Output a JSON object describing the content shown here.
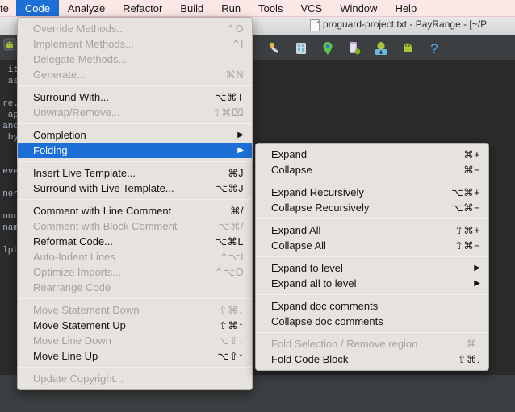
{
  "window": {
    "title": "proguard-project.txt - PayRange - [~/P",
    "doc_icon": "document-icon"
  },
  "toolbar": {
    "icons": [
      {
        "name": "sdk-manager-icon",
        "color": "#e8b54d"
      },
      {
        "name": "avd-manager-icon",
        "color": "#6fb8e0"
      },
      {
        "name": "location-pin-icon",
        "color": "#5fc14e"
      },
      {
        "name": "device-monitor-icon",
        "color": "#c9a3e0"
      },
      {
        "name": "sync-gradle-icon",
        "color": "#6fb8e0"
      },
      {
        "name": "android-icon",
        "color": "#a4c639"
      },
      {
        "name": "help-icon",
        "color": "#4aa3e8"
      }
    ]
  },
  "editor": {
    "lines": [
      "it",
      "as",
      "",
      "re.",
      "ap",
      "and",
      " by",
      "",
      "",
      "eve",
      "",
      "ner",
      "",
      "unc",
      "nam",
      "",
      "lpt"
    ]
  },
  "menubar": {
    "items": [
      {
        "label": "te",
        "active": false,
        "clipped": true
      },
      {
        "label": "Code",
        "active": true,
        "clipped": false
      },
      {
        "label": "Analyze",
        "active": false,
        "clipped": false
      },
      {
        "label": "Refactor",
        "active": false,
        "clipped": false
      },
      {
        "label": "Build",
        "active": false,
        "clipped": false
      },
      {
        "label": "Run",
        "active": false,
        "clipped": false
      },
      {
        "label": "Tools",
        "active": false,
        "clipped": false
      },
      {
        "label": "VCS",
        "active": false,
        "clipped": false
      },
      {
        "label": "Window",
        "active": false,
        "clipped": false
      },
      {
        "label": "Help",
        "active": false,
        "clipped": false
      }
    ]
  },
  "code_menu": {
    "name": "Code",
    "items": [
      {
        "type": "item",
        "label": "Override Methods...",
        "shortcut": "⌃O",
        "disabled": true,
        "submenu": false
      },
      {
        "type": "item",
        "label": "Implement Methods...",
        "shortcut": "⌃I",
        "disabled": true,
        "submenu": false
      },
      {
        "type": "item",
        "label": "Delegate Methods...",
        "shortcut": "",
        "disabled": true,
        "submenu": false
      },
      {
        "type": "item",
        "label": "Generate...",
        "shortcut": "⌘N",
        "disabled": true,
        "submenu": false
      },
      {
        "type": "separator"
      },
      {
        "type": "item",
        "label": "Surround With...",
        "shortcut": "⌥⌘T",
        "disabled": false,
        "submenu": false
      },
      {
        "type": "item",
        "label": "Unwrap/Remove...",
        "shortcut": "⇧⌘⌧",
        "disabled": true,
        "submenu": false
      },
      {
        "type": "separator"
      },
      {
        "type": "item",
        "label": "Completion",
        "shortcut": "",
        "disabled": false,
        "submenu": true
      },
      {
        "type": "item",
        "label": "Folding",
        "shortcut": "",
        "disabled": false,
        "submenu": true,
        "highlight": true
      },
      {
        "type": "separator"
      },
      {
        "type": "item",
        "label": "Insert Live Template...",
        "shortcut": "⌘J",
        "disabled": false,
        "submenu": false
      },
      {
        "type": "item",
        "label": "Surround with Live Template...",
        "shortcut": "⌥⌘J",
        "disabled": false,
        "submenu": false
      },
      {
        "type": "separator"
      },
      {
        "type": "item",
        "label": "Comment with Line Comment",
        "shortcut": "⌘/",
        "disabled": false,
        "submenu": false
      },
      {
        "type": "item",
        "label": "Comment with Block Comment",
        "shortcut": "⌥⌘/",
        "disabled": true,
        "submenu": false
      },
      {
        "type": "item",
        "label": "Reformat Code...",
        "shortcut": "⌥⌘L",
        "disabled": false,
        "submenu": false
      },
      {
        "type": "item",
        "label": "Auto-Indent Lines",
        "shortcut": "⌃⌥I",
        "disabled": true,
        "submenu": false
      },
      {
        "type": "item",
        "label": "Optimize Imports...",
        "shortcut": "⌃⌥O",
        "disabled": true,
        "submenu": false
      },
      {
        "type": "item",
        "label": "Rearrange Code",
        "shortcut": "",
        "disabled": true,
        "submenu": false
      },
      {
        "type": "separator"
      },
      {
        "type": "item",
        "label": "Move Statement Down",
        "shortcut": "⇧⌘↓",
        "disabled": true,
        "submenu": false
      },
      {
        "type": "item",
        "label": "Move Statement Up",
        "shortcut": "⇧⌘↑",
        "disabled": false,
        "submenu": false
      },
      {
        "type": "item",
        "label": "Move Line Down",
        "shortcut": "⌥⇧↓",
        "disabled": true,
        "submenu": false
      },
      {
        "type": "item",
        "label": "Move Line Up",
        "shortcut": "⌥⇧↑",
        "disabled": false,
        "submenu": false
      },
      {
        "type": "separator"
      },
      {
        "type": "item",
        "label": "Update Copyright...",
        "shortcut": "",
        "disabled": true,
        "submenu": false
      }
    ]
  },
  "folding_submenu": {
    "name": "Folding",
    "items": [
      {
        "type": "item",
        "label": "Expand",
        "shortcut": "⌘+",
        "disabled": false,
        "submenu": false
      },
      {
        "type": "item",
        "label": "Collapse",
        "shortcut": "⌘−",
        "disabled": false,
        "submenu": false
      },
      {
        "type": "separator"
      },
      {
        "type": "item",
        "label": "Expand Recursively",
        "shortcut": "⌥⌘+",
        "disabled": false,
        "submenu": false
      },
      {
        "type": "item",
        "label": "Collapse Recursively",
        "shortcut": "⌥⌘−",
        "disabled": false,
        "submenu": false
      },
      {
        "type": "separator"
      },
      {
        "type": "item",
        "label": "Expand All",
        "shortcut": "⇧⌘+",
        "disabled": false,
        "submenu": false
      },
      {
        "type": "item",
        "label": "Collapse All",
        "shortcut": "⇧⌘−",
        "disabled": false,
        "submenu": false
      },
      {
        "type": "separator"
      },
      {
        "type": "item",
        "label": "Expand to level",
        "shortcut": "",
        "disabled": false,
        "submenu": true
      },
      {
        "type": "item",
        "label": "Expand all to level",
        "shortcut": "",
        "disabled": false,
        "submenu": true
      },
      {
        "type": "separator"
      },
      {
        "type": "item",
        "label": "Expand doc comments",
        "shortcut": "",
        "disabled": false,
        "submenu": false
      },
      {
        "type": "item",
        "label": "Collapse doc comments",
        "shortcut": "",
        "disabled": false,
        "submenu": false
      },
      {
        "type": "separator"
      },
      {
        "type": "item",
        "label": "Fold Selection / Remove region",
        "shortcut": "⌘.",
        "disabled": true,
        "submenu": false
      },
      {
        "type": "item",
        "label": "Fold Code Block",
        "shortcut": "⇧⌘.",
        "disabled": false,
        "submenu": false
      }
    ]
  },
  "colors": {
    "menubar_bg": "#fbe8e6",
    "highlight": "#1d6fd8",
    "menu_bg": "#e6e2dd",
    "ide_bg": "#2b2b2b",
    "toolbar_bg": "#3c3f41"
  }
}
